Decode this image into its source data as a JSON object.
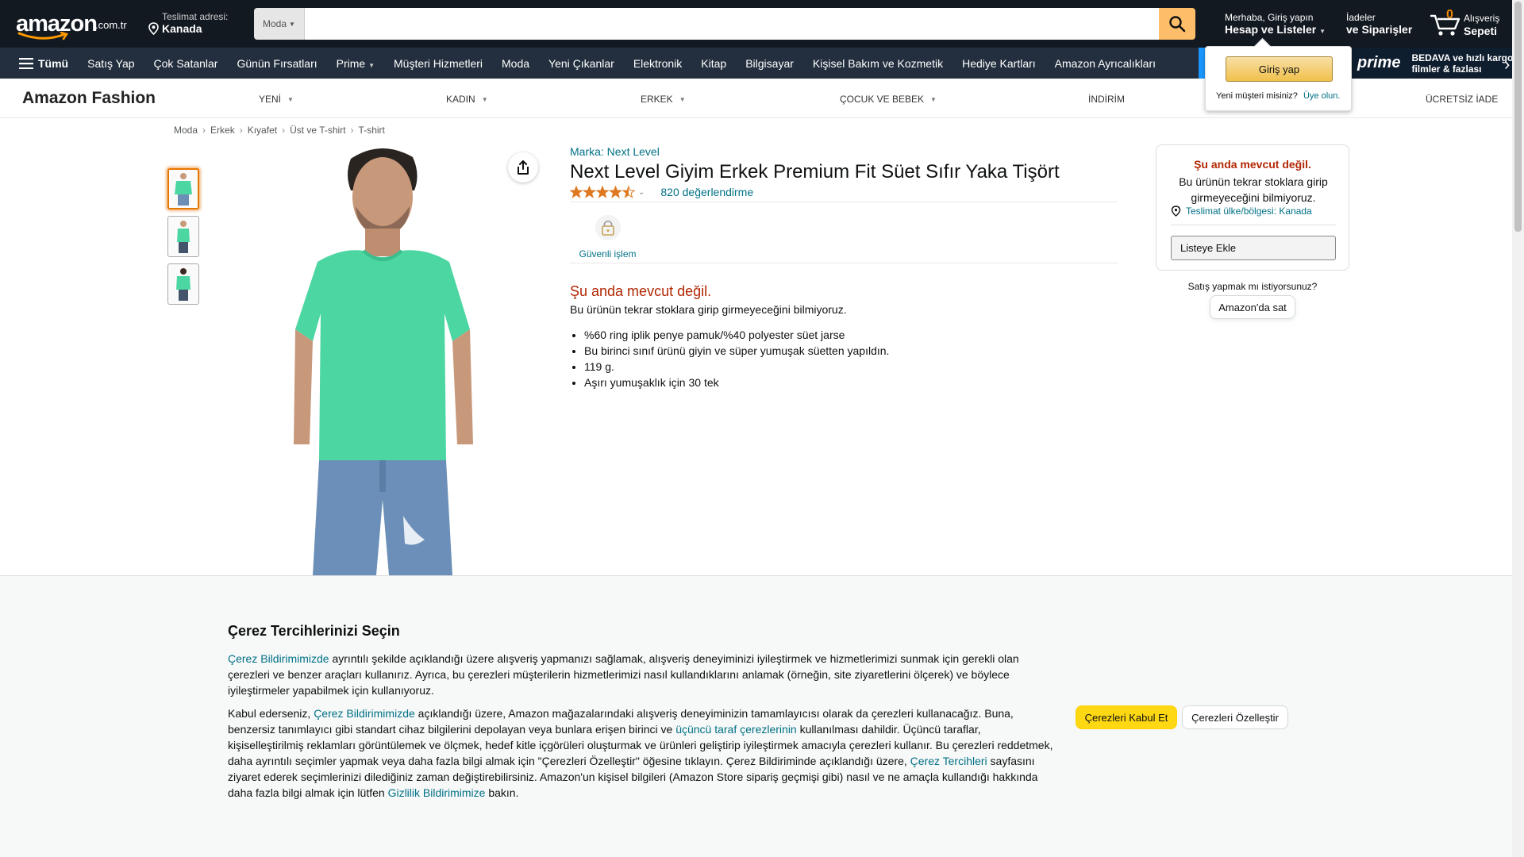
{
  "header": {
    "logo_text": "amazon",
    "logo_tld": ".com.tr",
    "deliver_label": "Teslimat adresi:",
    "deliver_location": "Kanada",
    "search_category": "Moda",
    "search_value": "",
    "account_greeting": "Merhaba, Giriş yapın",
    "account_label": "Hesap ve Listeler",
    "orders_line1": "İadeler",
    "orders_line2": "ve Siparişler",
    "cart_count": "0",
    "cart_line1": "Alışveriş",
    "cart_line2": "Sepeti"
  },
  "main_nav": {
    "all_label": "Tümü",
    "items": [
      "Satış Yap",
      "Çok Satanlar",
      "Günün Fırsatları",
      "Prime",
      "Müşteri Hizmetleri",
      "Moda",
      "Yeni Çıkanlar",
      "Elektronik",
      "Kitap",
      "Bilgisayar",
      "Kişisel Bakım ve Kozmetik",
      "Hediye Kartları",
      "Amazon Ayrıcalıkları"
    ],
    "prime_word": "prime",
    "prime_text_1": "BEDAVA ve hızlı kargo,",
    "prime_text_2": "filmler & fazlası"
  },
  "fashion_nav": {
    "logo": "Amazon Fashion",
    "items": [
      "YENİ",
      "KADIN",
      "ERKEK",
      "ÇOCUK VE BEBEK",
      "İNDİRİM",
      "ÜCRETSİZ İADE"
    ]
  },
  "signin_popover": {
    "button": "Giriş yap",
    "new_customer": "Yeni müşteri misiniz?",
    "signup_link": "Üye olun."
  },
  "breadcrumb": [
    "Moda",
    "Erkek",
    "Kıyafet",
    "Üst ve T-shirt",
    "T-shirt"
  ],
  "product": {
    "brand": "Marka: Next Level",
    "title": "Next Level Giyim Erkek Premium Fit Süet Sıfır Yaka Tişört",
    "rating": 4.5,
    "rating_count": "820 değerlendirme",
    "secure_label": "Güvenli işlem",
    "unavailable": "Şu anda mevcut değil.",
    "unavailable_sub": "Bu ürünün tekrar stoklara girip girmeyeceğini bilmiyoruz.",
    "bullets": [
      "%60 ring iplik penye pamuk/%40 polyester süet jarse",
      "Bu birinci sınıf ürünü giyin ve süper yumuşak süetten yapıldın.",
      "119 g.",
      "Aşırı yumuşaklık için 30 tek"
    ],
    "shirt_color": "#4cd6a1"
  },
  "buybox": {
    "title": "Şu anda mevcut değil.",
    "sub": "Bu ürünün tekrar stoklara girip girmeyeceğini bilmiyoruz.",
    "location": "Teslimat ülke/bölgesi: Kanada",
    "add_to_list": "Listeye Ekle",
    "sell_question": "Satış yapmak mı istiyorsunuz?",
    "sell_button": "Amazon'da sat"
  },
  "cookie": {
    "title": "Çerez Tercihlerinizi Seçin",
    "p1_link": "Çerez Bildirimimizde",
    "p1_text": " ayrıntılı şekilde açıklandığı üzere alışveriş yapmanızı sağlamak, alışveriş deneyiminizi iyileştirmek ve hizmetlerimizi sunmak için gerekli olan çerezleri ve benzer araçları kullanırız. Ayrıca, bu çerezleri müşterilerin hizmetlerimizi nasıl kullandıklarını anlamak (örneğin, site ziyaretlerini ölçerek) ve böylece iyileştirmeler yapabilmek için kullanıyoruz.",
    "p2_a": "Kabul ederseniz, ",
    "p2_link1": "Çerez Bildirimimizde",
    "p2_b": " açıklandığı üzere, Amazon mağazalarındaki alışveriş deneyiminizin tamamlayıcısı olarak da çerezleri kullanacağız. Buna, benzersiz tanımlayıcı gibi standart cihaz bilgilerini depolayan veya bunlara erişen birinci ve ",
    "p2_link2": "üçüncü taraf çerezlerinin",
    "p2_c": " kullanılması dahildir. Üçüncü taraflar, kişiselleştirilmiş reklamları görüntülemek ve ölçmek, hedef kitle içgörüleri oluşturmak ve ürünleri geliştirip iyileştirmek amacıyla çerezleri kullanır. Bu çerezleri reddetmek, daha ayrıntılı seçimler yapmak veya daha fazla bilgi almak için \"Çerezleri Özelleştir\" öğesine tıklayın. Çerez Bildiriminde açıklandığı üzere, ",
    "p2_link3": "Çerez Tercihleri",
    "p2_d": " sayfasını ziyaret ederek seçimlerinizi dilediğiniz zaman değiştirebilirsiniz. Amazon'un kişisel bilgileri (Amazon Store sipariş geçmişi gibi) nasıl ve ne amaçla kullandığı hakkında daha fazla bilgi almak için lütfen ",
    "p2_link4": "Gizlilik Bildirimimize",
    "p2_e": " bakın.",
    "accept": "Çerezleri Kabul Et",
    "customize": "Çerezleri Özelleştir"
  },
  "colors": {
    "nav_dark": "#131921",
    "nav_secondary": "#232f3e",
    "search_button": "#febd69",
    "unavailable_red": "#b12704",
    "link_teal": "#007185",
    "accept_yellow": "#ffd814"
  }
}
